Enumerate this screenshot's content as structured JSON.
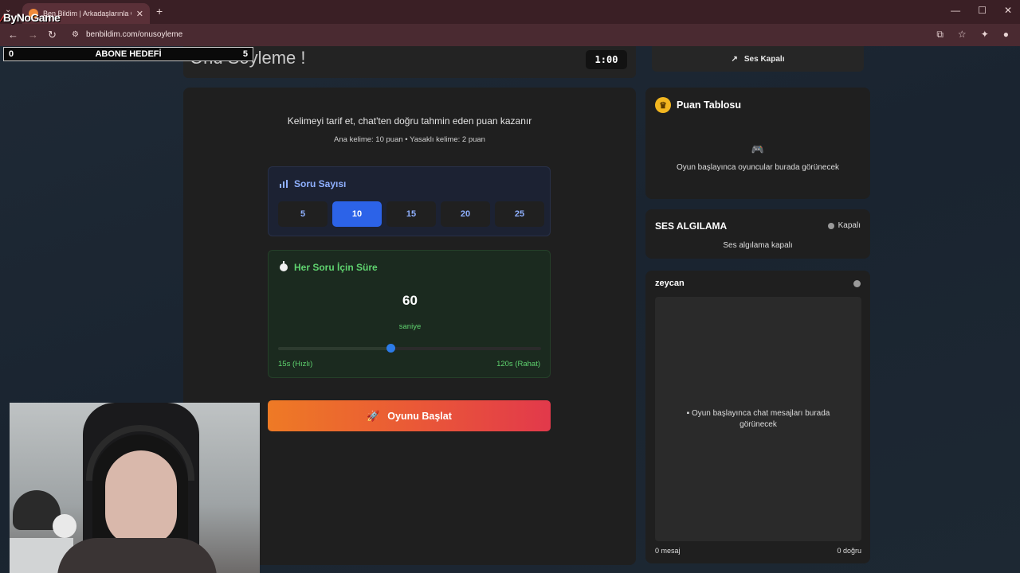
{
  "browser": {
    "tab_title": "Ben Bildim | Arkadaşlarınla Onu S...",
    "tab_close": "✕",
    "new_tab": "+",
    "url": "benbildim.com/onusoyleme"
  },
  "overlay": {
    "brand": "ByNoGame",
    "sub_goal_left": "0",
    "sub_goal_label": "ABONE HEDEFİ",
    "sub_goal_right": "5"
  },
  "header": {
    "title": "Onu Söyleme !",
    "timer": "1:00"
  },
  "intro": {
    "line1": "Kelimeyi tarif et, chat'ten doğru tahmin eden puan kazanır",
    "line2": "Ana kelime: 10 puan • Yasaklı kelime: 2 puan"
  },
  "questions": {
    "title": "Soru Sayısı",
    "options": [
      "5",
      "10",
      "15",
      "20",
      "25"
    ],
    "selected": "10"
  },
  "timing": {
    "title": "Her Soru İçin Süre",
    "value": "60",
    "unit": "saniye",
    "min_label": "15s (Hızlı)",
    "max_label": "120s (Rahat)",
    "min": 15,
    "max": 120,
    "current": 60
  },
  "start_button": {
    "label": "Oyunu Başlat"
  },
  "sidebar": {
    "sound_label": "Ses Kapalı",
    "scoreboard": {
      "title": "Puan Tablosu",
      "empty": "Oyun başlayınca oyuncular burada görünecek"
    },
    "voice": {
      "title": "SES ALGILAMA",
      "status": "Kapalı",
      "subtitle": "Ses algılama kapalı"
    },
    "chat": {
      "user": "zeycan",
      "empty": "Oyun başlayınca chat mesajları burada görünecek",
      "message_count": "0 mesaj",
      "correct_count": "0 doğru"
    }
  },
  "colors": {
    "accent_blue": "#2c63e8",
    "accent_green": "#5fd36f",
    "start_gradient_from": "#ee7a25",
    "start_gradient_to": "#e2394b",
    "trophy": "#f2b620"
  },
  "icons": {
    "questions": "bar-chart-icon",
    "timing": "stopwatch-icon",
    "start": "rocket-icon",
    "sound": "muted-speaker-icon",
    "scoreboard": "trophy-icon",
    "empty_players": "gamepad-icon",
    "chat_empty": "speech-bubble-icon"
  }
}
